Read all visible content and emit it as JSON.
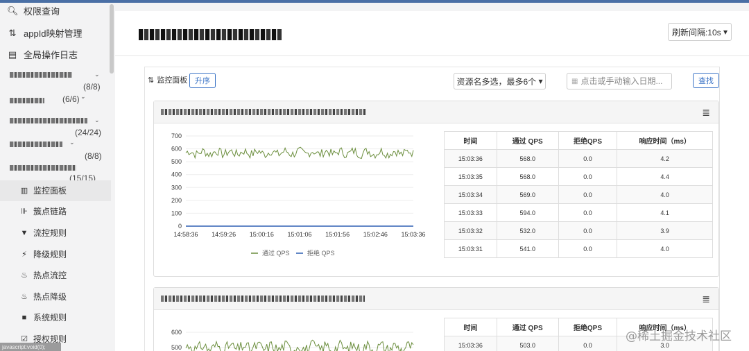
{
  "sidebar": {
    "top_items": [
      {
        "icon": "search-icon",
        "glyph": "🔍",
        "label": "权限查询"
      },
      {
        "icon": "sync-icon",
        "glyph": "⇅",
        "label": "appId映射管理"
      },
      {
        "icon": "list-icon",
        "glyph": "▤",
        "label": "全局操作日志"
      }
    ],
    "groups": [
      {
        "count": "(8/8)"
      },
      {
        "count": "(6/6)"
      },
      {
        "count": "(24/24)"
      },
      {
        "count": "(8/8)"
      },
      {
        "count": "(15/15)"
      }
    ],
    "sub_items": [
      {
        "icon": "bar-chart-icon",
        "glyph": "▥",
        "label": "监控面板"
      },
      {
        "icon": "link-icon",
        "glyph": "⊪",
        "label": "簇点链路"
      },
      {
        "icon": "filter-icon",
        "glyph": "▼",
        "label": "流控规则"
      },
      {
        "icon": "bolt-icon",
        "glyph": "⚡",
        "label": "降级规则"
      },
      {
        "icon": "fire-icon",
        "glyph": "♨",
        "label": "热点流控"
      },
      {
        "icon": "fire-icon",
        "glyph": "♨",
        "label": "热点降级"
      },
      {
        "icon": "lock-icon",
        "glyph": "■",
        "label": "系统规则"
      },
      {
        "icon": "check-square-icon",
        "glyph": "☑",
        "label": "授权规则"
      }
    ],
    "status": "javascript:void(0);"
  },
  "header": {
    "refresh_label": "刷新间隔:10s",
    "refresh_caret": "▾"
  },
  "toolbar": {
    "panel_label": "监控面板",
    "sort_button": "升序",
    "resource_select": "资源名多选，最多6个",
    "date_placeholder": "点击或手动输入日期...",
    "search_button": "查找"
  },
  "table": {
    "columns": [
      "时间",
      "通过 QPS",
      "拒绝QPS",
      "响应时间（ms）"
    ],
    "card1_rows": [
      [
        "15:03:36",
        "568.0",
        "0.0",
        "4.2"
      ],
      [
        "15:03:35",
        "568.0",
        "0.0",
        "4.4"
      ],
      [
        "15:03:34",
        "569.0",
        "0.0",
        "4.0"
      ],
      [
        "15:03:33",
        "594.0",
        "0.0",
        "4.1"
      ],
      [
        "15:03:32",
        "532.0",
        "0.0",
        "3.9"
      ],
      [
        "15:03:31",
        "541.0",
        "0.0",
        "4.0"
      ]
    ],
    "card2_rows": [
      [
        "15:03:36",
        "503.0",
        "0.0",
        "3.0"
      ]
    ]
  },
  "chart_data": [
    {
      "type": "line",
      "x_ticks": [
        "14:58:36",
        "14:59:26",
        "15:00:16",
        "15:01:06",
        "15:01:56",
        "15:02:46",
        "15:03:36"
      ],
      "y_ticks": [
        0,
        100,
        200,
        300,
        400,
        500,
        600,
        700
      ],
      "ylim": [
        0,
        700
      ],
      "series": [
        {
          "name": "通过 QPS",
          "color": "#6b8e3d",
          "approx_level": 570,
          "approx_range": [
            520,
            620
          ]
        },
        {
          "name": "拒绝 QPS",
          "color": "#2e5fb3",
          "approx_level": 0
        }
      ],
      "legend": "bottom"
    },
    {
      "type": "line",
      "y_ticks": [
        500,
        600
      ],
      "series": [
        {
          "name": "通过 QPS",
          "color": "#6b8e3d",
          "approx_level": 500,
          "approx_range": [
            450,
            560
          ]
        }
      ]
    }
  ],
  "watermark": "@稀土掘金技术社区"
}
